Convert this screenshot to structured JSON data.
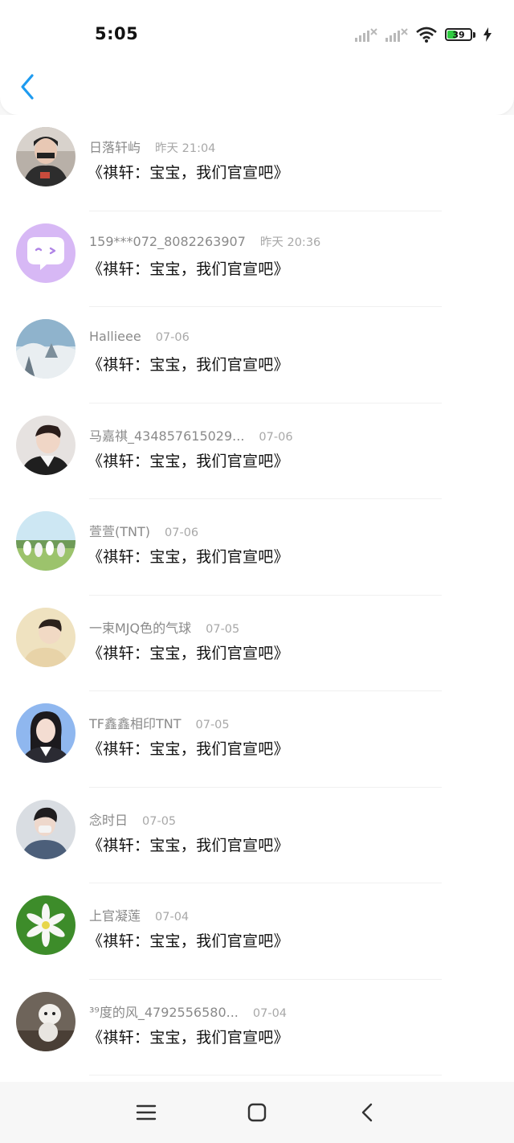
{
  "status_bar": {
    "time": "5:05",
    "battery_level": "39",
    "icons": [
      "signal-1-off-icon",
      "signal-2-off-icon",
      "wifi-icon",
      "battery-icon",
      "charging-icon"
    ]
  },
  "header": {
    "back_icon": "chevron-left-icon",
    "accent_color": "#1e9bf0"
  },
  "items": [
    {
      "name": "日落轩屿",
      "time": "昨天 21:04",
      "message": "《祺轩：宝宝，我们官宣吧》",
      "avatar": "photo"
    },
    {
      "name": "159***072_8082263907",
      "time": "昨天 20:36",
      "message": "《祺轩：宝宝，我们官宣吧》",
      "avatar": "default-chat-bubble"
    },
    {
      "name": "Hallieee",
      "time": "07-06",
      "message": "《祺轩：宝宝，我们官宣吧》",
      "avatar": "photo"
    },
    {
      "name": "马嘉祺_434857615029...",
      "time": "07-06",
      "message": "《祺轩：宝宝，我们官宣吧》",
      "avatar": "photo"
    },
    {
      "name": "萱萱(TNT)",
      "time": "07-06",
      "message": "《祺轩：宝宝，我们官宣吧》",
      "avatar": "photo"
    },
    {
      "name": "一束MJQ色的气球",
      "time": "07-05",
      "message": "《祺轩：宝宝，我们官宣吧》",
      "avatar": "photo"
    },
    {
      "name": "TF鑫鑫相印TNT",
      "time": "07-05",
      "message": "《祺轩：宝宝，我们官宣吧》",
      "avatar": "photo"
    },
    {
      "name": "念时日",
      "time": "07-05",
      "message": "《祺轩：宝宝，我们官宣吧》",
      "avatar": "photo"
    },
    {
      "name": "上官凝莲",
      "time": "07-04",
      "message": "《祺轩：宝宝，我们官宣吧》",
      "avatar": "flower-photo"
    },
    {
      "name": "³⁹度的风_4792556580...",
      "time": "07-04",
      "message": "《祺轩：宝宝，我们官宣吧》",
      "avatar": "photo"
    }
  ],
  "navigation_bar": {
    "icons": [
      "menu-icon",
      "home-icon",
      "back-icon"
    ]
  }
}
